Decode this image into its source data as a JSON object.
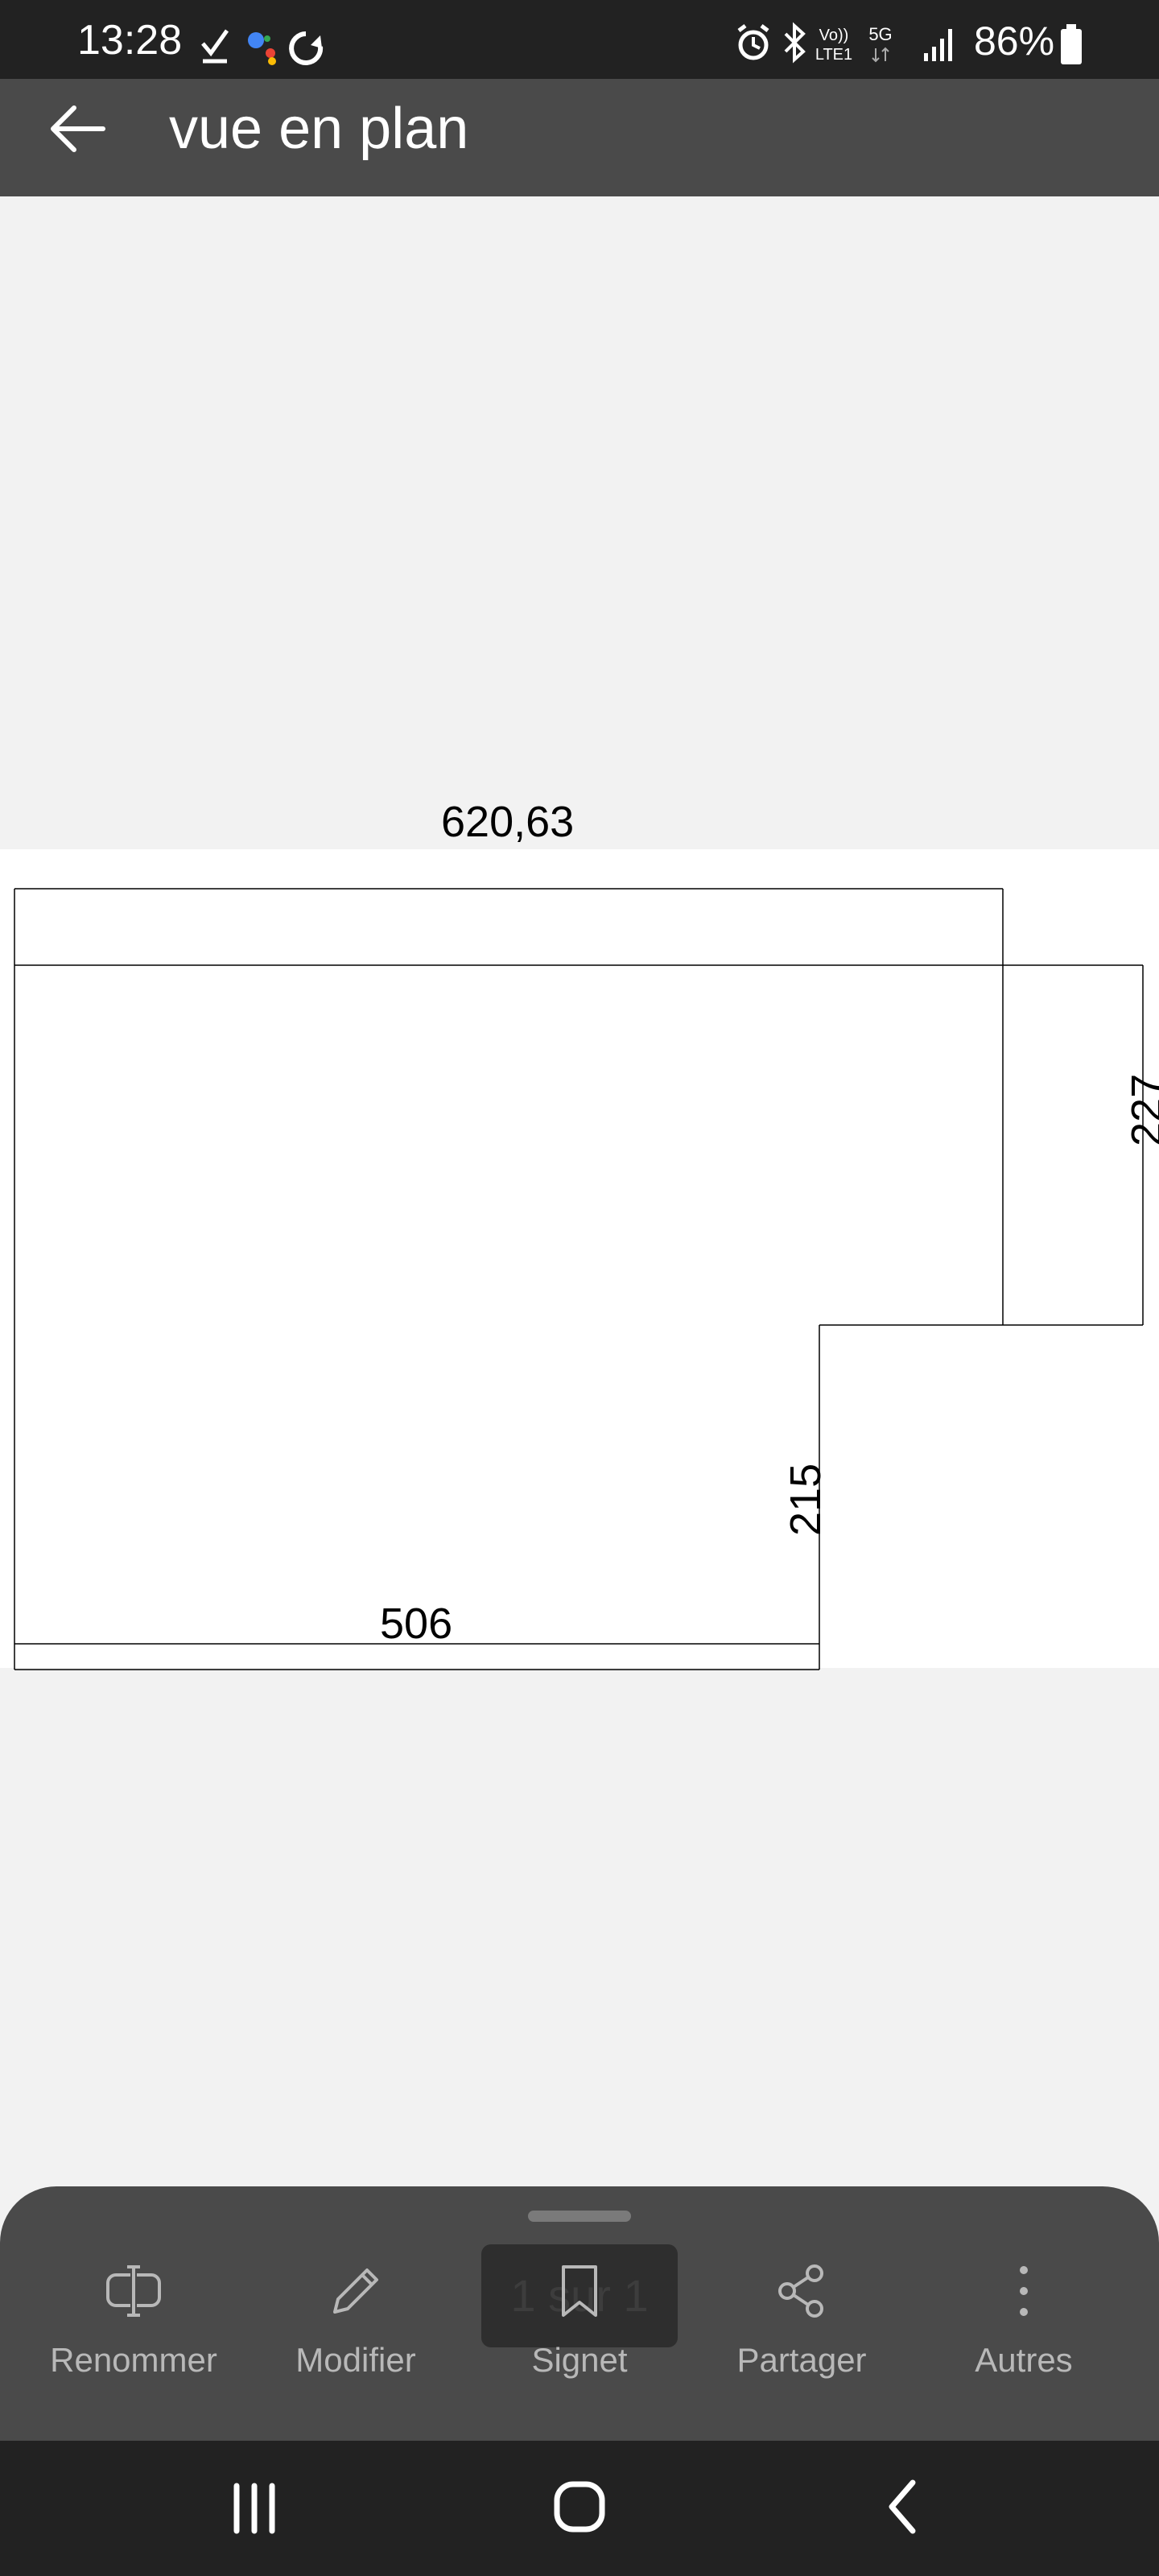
{
  "status_bar": {
    "time": "13:28",
    "battery": "86%",
    "left_icons": [
      "check-icon",
      "google-assistant-icon",
      "sync-icon"
    ],
    "right_icons": [
      "alarm-icon",
      "bluetooth-icon",
      "volte-icon",
      "5g-icon",
      "signal-icon",
      "battery-icon"
    ],
    "volte_top": "Vo))",
    "volte_bottom": "LTE1",
    "network": "5G"
  },
  "app_bar": {
    "title": "vue en plan",
    "back_icon": "arrow-left-icon"
  },
  "document": {
    "dimensions": {
      "top": "620,63",
      "right": "227",
      "middle": "215",
      "bottom": "506"
    }
  },
  "bottom_sheet": {
    "page_indicator": "1 sur 1",
    "actions": [
      {
        "label": "Renommer",
        "icon": "rename-icon"
      },
      {
        "label": "Modifier",
        "icon": "pencil-icon"
      },
      {
        "label": "Signet",
        "icon": "bookmark-icon"
      },
      {
        "label": "Partager",
        "icon": "share-icon"
      },
      {
        "label": "Autres",
        "icon": "more-vertical-icon"
      }
    ]
  },
  "nav_bar": {
    "buttons": [
      "recent-apps-icon",
      "home-icon",
      "back-icon"
    ]
  },
  "colors": {
    "status_bar": "#222222",
    "app_bar": "#4a4a4a",
    "background": "#f2f2f2",
    "page": "#ffffff",
    "sheet": "#4a4a4a",
    "action_text": "#b8b8b8"
  }
}
